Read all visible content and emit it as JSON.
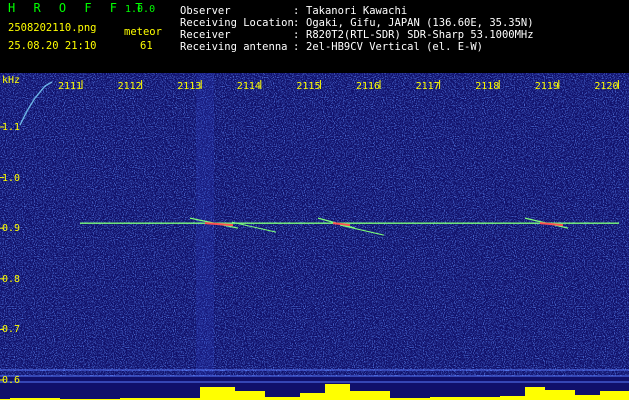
{
  "header": {
    "app_name": "H R O F F T",
    "app_version": "1.0.0",
    "file_name": "2508202110.png",
    "datetime": "25.08.20 21:10",
    "meteor_label": "meteor",
    "meteor_count": "61",
    "info": [
      {
        "label": "Observer",
        "value": "Takanori Kawachi"
      },
      {
        "label": "Receiving Location",
        "value": "Ogaki, Gifu, JAPAN (136.60E, 35.35N)"
      },
      {
        "label": "Receiver",
        "value": "R820T2(RTL-SDR) SDR-Sharp 53.1000MHz"
      },
      {
        "label": "Receiving antenna",
        "value": "2el-HB9CV Vertical (el. E-W)"
      }
    ],
    "colon": ":"
  },
  "chart_data": {
    "type": "heatmap",
    "y_unit": "kHz",
    "x_ticks": [
      "2111",
      "2112",
      "2113",
      "2114",
      "2115",
      "2116",
      "2117",
      "2118",
      "2119",
      "2120"
    ],
    "y_ticks": [
      "1.1",
      "1.0",
      "0.9",
      "0.8",
      "0.7",
      "0.6"
    ],
    "y_tick_values": [
      1.1,
      1.0,
      0.9,
      0.8,
      0.7,
      0.6
    ],
    "carrier_khz": 0.91,
    "colors": {
      "background": "#10106a",
      "noise": "#2a3cc0",
      "carrier": "#7cff7c",
      "meteor": "#ff5050",
      "level_bars": "#ffff00",
      "band_lines": "#5a7cff",
      "text_yellow": "#ffff00",
      "text_green": "#00ff00"
    }
  }
}
